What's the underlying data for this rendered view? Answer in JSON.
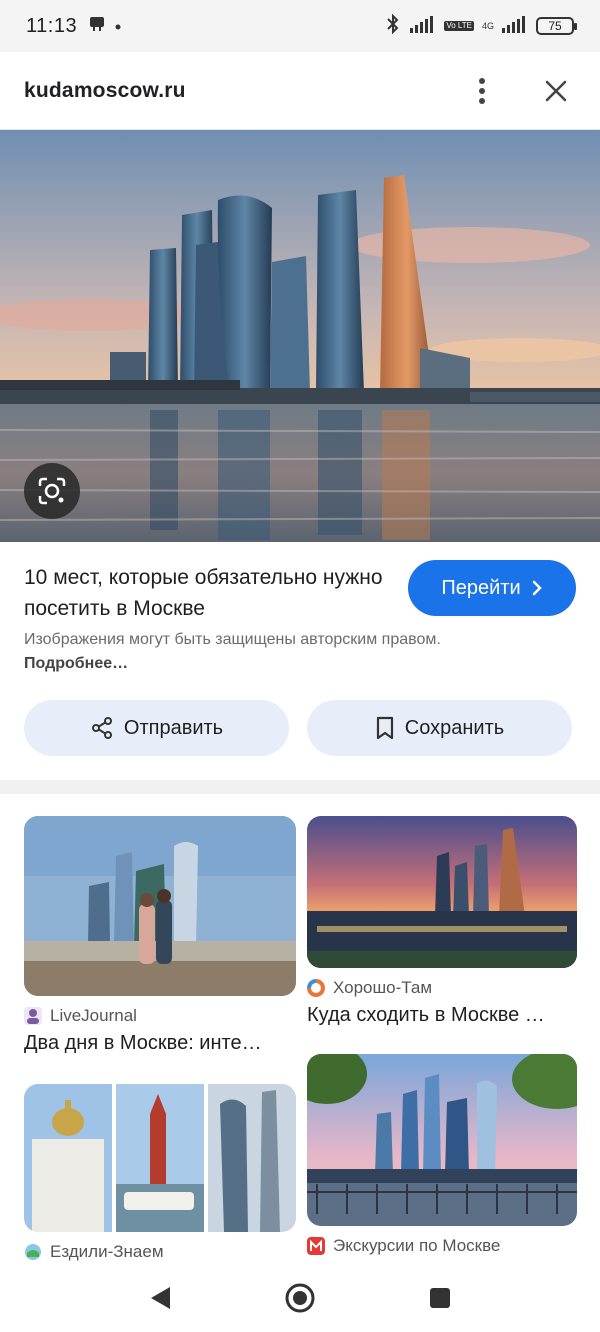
{
  "status_bar": {
    "time": "11:13",
    "battery": "75",
    "volte": "Vo LTE",
    "network": "4G"
  },
  "header": {
    "domain": "kudamoscow.ru"
  },
  "hero": {
    "lens_icon": "lens-icon"
  },
  "info": {
    "title": "10 мест, которые обязательно нужно посетить в Москве",
    "go_label": "Перейти",
    "copyright_text": "Изображения могут быть защищены авторским правом.",
    "more_link": "Подробнее…",
    "share_label": "Отправить",
    "save_label": "Сохранить"
  },
  "related": [
    {
      "source": "LiveJournal",
      "title": "Два дня в Москве: инте…",
      "source_color": "#7a5c9e"
    },
    {
      "source": "Хорошо-Там",
      "title": "Куда сходить в Москве …",
      "source_color": "#e8763a"
    },
    {
      "source": "Ездили-Знаем",
      "title": "",
      "source_color": "#4caf50"
    },
    {
      "source": "Экскурсии по Москве",
      "title": "",
      "source_color": "#e53935"
    }
  ],
  "colors": {
    "accent": "#1a73e8",
    "chip_bg": "#e8eef9"
  }
}
